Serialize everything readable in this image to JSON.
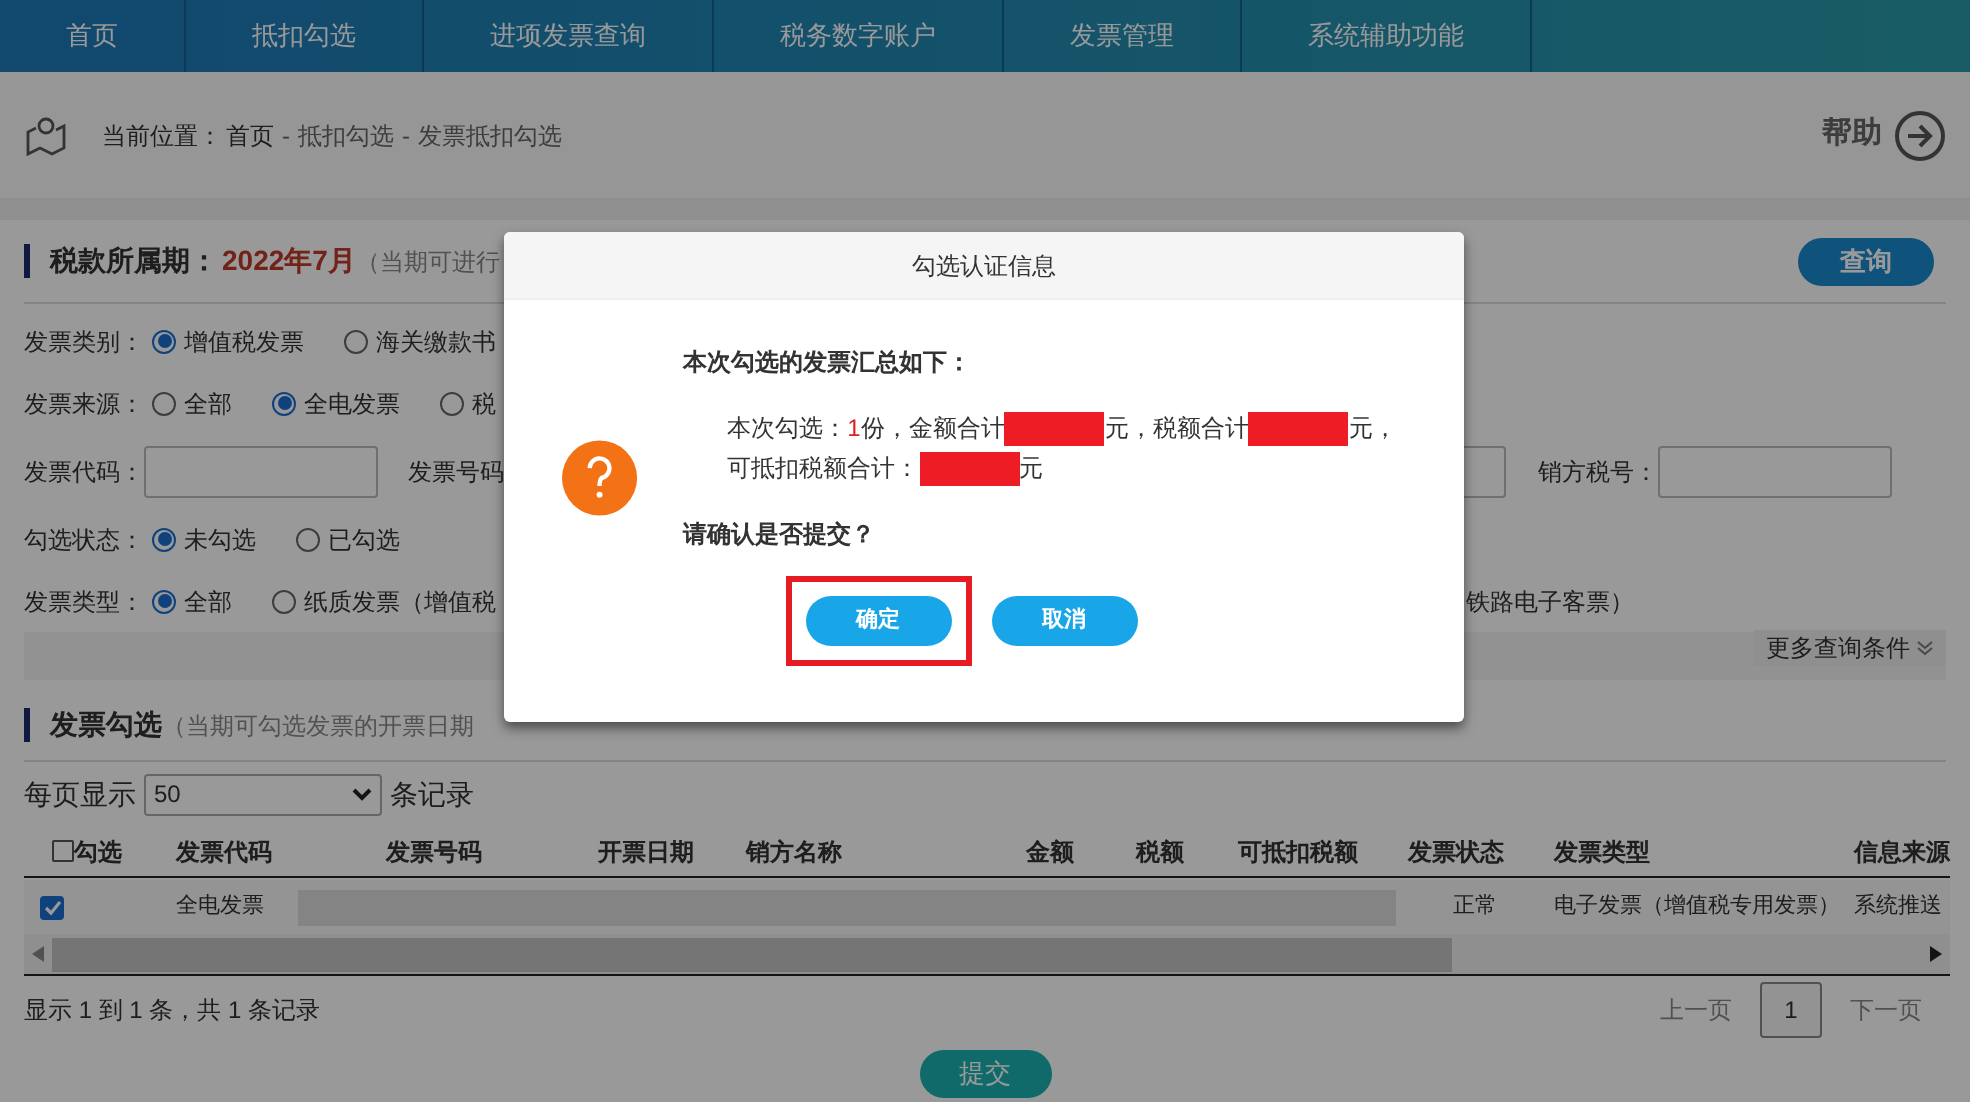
{
  "nav": [
    {
      "label": "首页"
    },
    {
      "label": "抵扣勾选"
    },
    {
      "label": "进项发票查询"
    },
    {
      "label": "税务数字账户"
    },
    {
      "label": "发票管理"
    },
    {
      "label": "系统辅助功能"
    }
  ],
  "breadcrumb": {
    "label": "当前位置：",
    "items": [
      "首页",
      "-",
      "抵扣勾选",
      "-",
      "发票抵扣勾选"
    ]
  },
  "help": "帮助",
  "period": {
    "label": "税款所属期：",
    "value": "2022年7月",
    "note": "（当期可进行"
  },
  "query_button": "查询",
  "filters": [
    {
      "kind": "radio",
      "label": "发票类别：",
      "options": [
        {
          "label": "增值税发票",
          "selected": true
        },
        {
          "label": "海关缴款书",
          "selected": false
        }
      ]
    },
    {
      "kind": "radio",
      "label": "发票来源：",
      "options": [
        {
          "label": "全部",
          "selected": false
        },
        {
          "label": "全电发票",
          "selected": true
        },
        {
          "label": "税",
          "selected": false
        }
      ]
    },
    {
      "kind": "fields",
      "fields": [
        {
          "label": "发票代码："
        },
        {
          "label": "发票号码"
        },
        {
          "label": "销方税号："
        }
      ]
    },
    {
      "kind": "radio",
      "label": "勾选状态：",
      "options": [
        {
          "label": "未勾选",
          "selected": true
        },
        {
          "label": "已勾选",
          "selected": false
        }
      ]
    },
    {
      "kind": "radio",
      "label": "发票类型：",
      "options": [
        {
          "label": "全部",
          "selected": true
        },
        {
          "label": "纸质发票（增值税",
          "selected": false
        }
      ],
      "tail": "铁路电子客票）"
    }
  ],
  "more_conditions": "更多查询条件",
  "selection": {
    "title": "发票勾选",
    "note": "（当期可勾选发票的开票日期"
  },
  "page_size": {
    "label": "每页显示",
    "value": "50",
    "suffix": "条记录"
  },
  "table": {
    "select_all": {
      "label": "勾选",
      "checked": false
    },
    "columns": [
      "发票代码",
      "发票号码",
      "开票日期",
      "销方名称",
      "金额",
      "税额",
      "可抵扣税额",
      "发票状态",
      "发票类型",
      "信息来源"
    ],
    "rows": [
      {
        "checked": true,
        "code": "全电发票",
        "status": "正常",
        "type": "电子发票（增值税专用发票）",
        "source": "系统推送"
      }
    ]
  },
  "footer": {
    "summary": "显示 1 到 1 条，共 1 条记录",
    "prev": "上一页",
    "pages": [
      {
        "label": "1",
        "selected": true
      }
    ],
    "next": "下一页"
  },
  "submit": "提交",
  "dialog": {
    "title": "勾选认证信息",
    "heading": "本次勾选的发票汇总如下：",
    "segments": [
      {
        "kind": "text",
        "text": "本次勾选："
      },
      {
        "kind": "count",
        "text": "1"
      },
      {
        "kind": "text",
        "text": "份，金额合计"
      },
      {
        "kind": "redacted"
      },
      {
        "kind": "text",
        "text": "元，税额合计"
      },
      {
        "kind": "redacted"
      },
      {
        "kind": "text",
        "text": "元，"
      },
      {
        "kind": "break"
      },
      {
        "kind": "text",
        "text": "可抵扣税额合计："
      },
      {
        "kind": "redacted"
      },
      {
        "kind": "text",
        "text": "元"
      }
    ],
    "question": "请确认是否提交？",
    "buttons": [
      {
        "label": "确定",
        "highlighted": true
      },
      {
        "label": "取消",
        "highlighted": false
      }
    ]
  }
}
